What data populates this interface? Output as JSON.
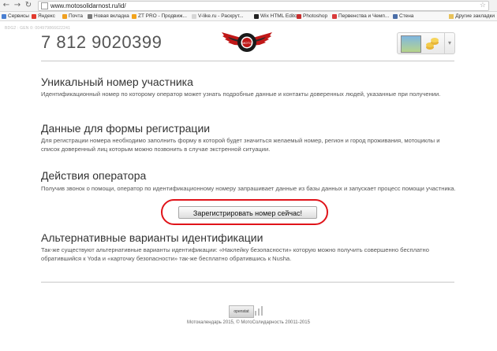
{
  "browser": {
    "back": "←",
    "forward": "→",
    "reload": "C",
    "url": "www.motosolidarnost.ru/id/",
    "bookmarks": [
      {
        "label": "Сервисы",
        "color": "#4a7fd1"
      },
      {
        "label": "Яндекс",
        "color": "#e23a2e"
      },
      {
        "label": "Почта",
        "color": "#f0a020"
      },
      {
        "label": "Новая вкладка",
        "color": "#7a7a7a"
      },
      {
        "label": "ZT PRO - Продвиж...",
        "color": "#f2a31b"
      },
      {
        "label": "V-like.ru - Раскрут...",
        "color": "#d6d6d6"
      },
      {
        "label": "Wix HTML Editor",
        "color": "#222222"
      },
      {
        "label": "Photoshop",
        "color": "#c82e2e"
      },
      {
        "label": "Первенства и Чемп...",
        "color": "#d93a3a"
      },
      {
        "label": "Стена",
        "color": "#4a6ea8"
      }
    ],
    "other_bookmarks": "Другие закладки"
  },
  "page": {
    "meta_id": "BDG2 : GEN 0: 004979866622241",
    "phone": "7 812 9020399",
    "logo_text": "МОТО",
    "sections": [
      {
        "title": "Уникальный номер участника",
        "text": "Идентификационный номер по которому оператор может узнать подробные данные и контакты доверенных людей, указанные при получении."
      },
      {
        "title": "Данные для формы регистрации",
        "text": "Для регистрации номера необходимо заполнить форму в которой будет значиться желаемый номер, регион и город проживания, мотоциклы и список доверенный лиц которым можно позвонить в случае экстренной ситуации."
      },
      {
        "title": "Действия оператора",
        "text": "Получив звонок о помощи, оператор по идентификационному номеру запрашивает данные из базы данных и запускает процесс помощи участника."
      },
      {
        "title": "Альтернативные варианты идентификации",
        "text": "Так-же существуют альтернативные варианты идентификации: «Наклейку безопасности» которую можно получить совершенно бесплатно обратившийся к Yoda и «карточку безопасности» так-же бесплатно обратившись к Nusha."
      }
    ],
    "cta_label": "Зарегистрировать номер сейчас!",
    "openstat_label": "openstat",
    "footer": "Мотокалендарь 2015, © МотоСолидарность 20011-2015"
  },
  "colors": {
    "ring": "#e0141a",
    "logo_red": "#c01818"
  }
}
